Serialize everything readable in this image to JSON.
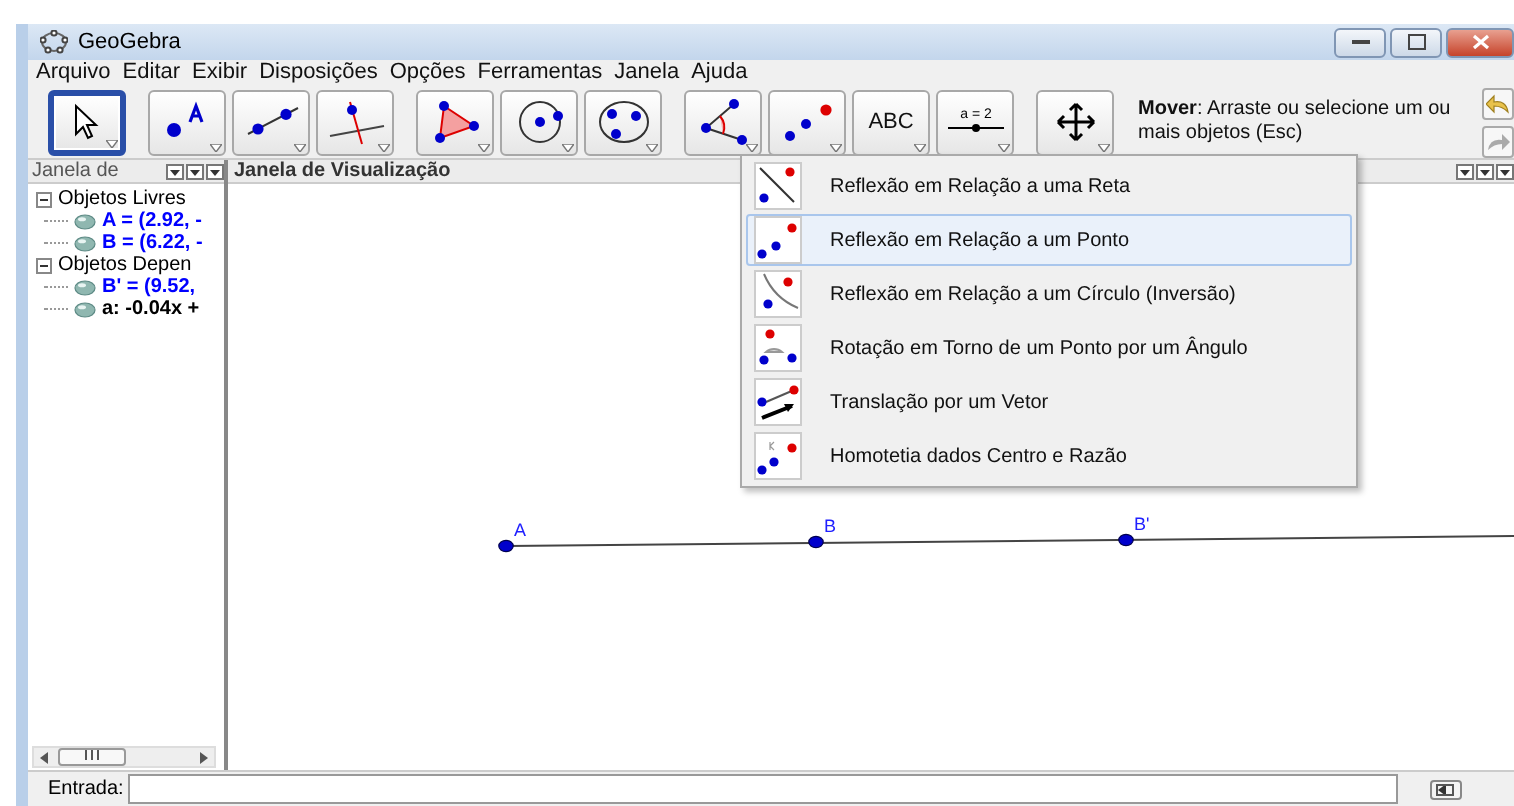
{
  "window": {
    "title": "GeoGebra"
  },
  "menu": [
    "Arquivo",
    "Editar",
    "Exibir",
    "Disposições",
    "Opções",
    "Ferramentas",
    "Janela",
    "Ajuda"
  ],
  "toolbar": {
    "groups": [
      {
        "tools": [
          {
            "kind": "move",
            "selected": true
          }
        ]
      },
      {
        "tools": [
          {
            "kind": "point",
            "selected": false
          },
          {
            "kind": "line",
            "selected": false
          },
          {
            "kind": "perpendicular",
            "selected": false
          }
        ]
      },
      {
        "tools": [
          {
            "kind": "polygon",
            "selected": false
          },
          {
            "kind": "circle",
            "selected": false
          },
          {
            "kind": "conic",
            "selected": false
          }
        ]
      },
      {
        "tools": [
          {
            "kind": "angle",
            "selected": false
          },
          {
            "kind": "reflect",
            "selected": false
          },
          {
            "kind": "text",
            "label": "ABC",
            "selected": false
          },
          {
            "kind": "slider",
            "label": "a = 2",
            "selected": false
          }
        ]
      },
      {
        "tools": [
          {
            "kind": "pan",
            "selected": false
          }
        ]
      }
    ],
    "help": "**Mover**: Arraste ou selecione um ou mais objetos (Esc)"
  },
  "algebra": {
    "title": "Janela de",
    "groups": [
      {
        "label": "Objetos Livres",
        "expanded": true,
        "children": [
          {
            "label": "A = (2.92, -",
            "color": "#0000ff"
          },
          {
            "label": "B = (6.22, -",
            "color": "#0000ff"
          }
        ]
      },
      {
        "label": "Objetos Depen",
        "expanded": true,
        "children": [
          {
            "label": "B' = (9.52,",
            "color": "#0000ff"
          },
          {
            "label": "a: -0.04x +",
            "color": "#000000"
          }
        ]
      }
    ]
  },
  "graphics": {
    "title": "Janela de Visualização",
    "points": [
      {
        "label": "A"
      },
      {
        "label": "B"
      },
      {
        "label": "B'"
      }
    ]
  },
  "popup": {
    "items": [
      {
        "kind": "reflect-line",
        "label": "Reflexão em Relação a uma Reta",
        "selected": false
      },
      {
        "kind": "reflect-point",
        "label": "Reflexão em Relação a um Ponto",
        "selected": true
      },
      {
        "kind": "reflect-circle",
        "label": "Reflexão em Relação a um Círculo (Inversão)",
        "selected": false
      },
      {
        "kind": "rotate",
        "label": "Rotação em Torno de um Ponto por um Ângulo",
        "selected": false
      },
      {
        "kind": "translate",
        "label": "Translação por um Vetor",
        "selected": false
      },
      {
        "kind": "dilate",
        "label": "Homotetia dados Centro e Razão",
        "selected": false
      }
    ]
  },
  "input": {
    "label": "Entrada:"
  }
}
